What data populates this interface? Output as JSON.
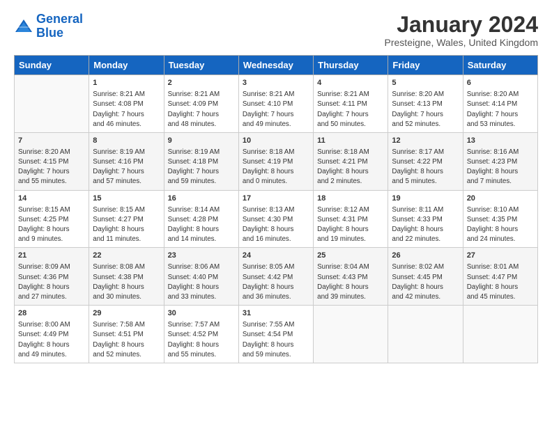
{
  "header": {
    "logo_line1": "General",
    "logo_line2": "Blue",
    "title": "January 2024",
    "subtitle": "Presteigne, Wales, United Kingdom"
  },
  "days_of_week": [
    "Sunday",
    "Monday",
    "Tuesday",
    "Wednesday",
    "Thursday",
    "Friday",
    "Saturday"
  ],
  "weeks": [
    [
      {
        "num": "",
        "data": []
      },
      {
        "num": "1",
        "data": [
          "Sunrise: 8:21 AM",
          "Sunset: 4:08 PM",
          "Daylight: 7 hours",
          "and 46 minutes."
        ]
      },
      {
        "num": "2",
        "data": [
          "Sunrise: 8:21 AM",
          "Sunset: 4:09 PM",
          "Daylight: 7 hours",
          "and 48 minutes."
        ]
      },
      {
        "num": "3",
        "data": [
          "Sunrise: 8:21 AM",
          "Sunset: 4:10 PM",
          "Daylight: 7 hours",
          "and 49 minutes."
        ]
      },
      {
        "num": "4",
        "data": [
          "Sunrise: 8:21 AM",
          "Sunset: 4:11 PM",
          "Daylight: 7 hours",
          "and 50 minutes."
        ]
      },
      {
        "num": "5",
        "data": [
          "Sunrise: 8:20 AM",
          "Sunset: 4:13 PM",
          "Daylight: 7 hours",
          "and 52 minutes."
        ]
      },
      {
        "num": "6",
        "data": [
          "Sunrise: 8:20 AM",
          "Sunset: 4:14 PM",
          "Daylight: 7 hours",
          "and 53 minutes."
        ]
      }
    ],
    [
      {
        "num": "7",
        "data": [
          "Sunrise: 8:20 AM",
          "Sunset: 4:15 PM",
          "Daylight: 7 hours",
          "and 55 minutes."
        ]
      },
      {
        "num": "8",
        "data": [
          "Sunrise: 8:19 AM",
          "Sunset: 4:16 PM",
          "Daylight: 7 hours",
          "and 57 minutes."
        ]
      },
      {
        "num": "9",
        "data": [
          "Sunrise: 8:19 AM",
          "Sunset: 4:18 PM",
          "Daylight: 7 hours",
          "and 59 minutes."
        ]
      },
      {
        "num": "10",
        "data": [
          "Sunrise: 8:18 AM",
          "Sunset: 4:19 PM",
          "Daylight: 8 hours",
          "and 0 minutes."
        ]
      },
      {
        "num": "11",
        "data": [
          "Sunrise: 8:18 AM",
          "Sunset: 4:21 PM",
          "Daylight: 8 hours",
          "and 2 minutes."
        ]
      },
      {
        "num": "12",
        "data": [
          "Sunrise: 8:17 AM",
          "Sunset: 4:22 PM",
          "Daylight: 8 hours",
          "and 5 minutes."
        ]
      },
      {
        "num": "13",
        "data": [
          "Sunrise: 8:16 AM",
          "Sunset: 4:23 PM",
          "Daylight: 8 hours",
          "and 7 minutes."
        ]
      }
    ],
    [
      {
        "num": "14",
        "data": [
          "Sunrise: 8:15 AM",
          "Sunset: 4:25 PM",
          "Daylight: 8 hours",
          "and 9 minutes."
        ]
      },
      {
        "num": "15",
        "data": [
          "Sunrise: 8:15 AM",
          "Sunset: 4:27 PM",
          "Daylight: 8 hours",
          "and 11 minutes."
        ]
      },
      {
        "num": "16",
        "data": [
          "Sunrise: 8:14 AM",
          "Sunset: 4:28 PM",
          "Daylight: 8 hours",
          "and 14 minutes."
        ]
      },
      {
        "num": "17",
        "data": [
          "Sunrise: 8:13 AM",
          "Sunset: 4:30 PM",
          "Daylight: 8 hours",
          "and 16 minutes."
        ]
      },
      {
        "num": "18",
        "data": [
          "Sunrise: 8:12 AM",
          "Sunset: 4:31 PM",
          "Daylight: 8 hours",
          "and 19 minutes."
        ]
      },
      {
        "num": "19",
        "data": [
          "Sunrise: 8:11 AM",
          "Sunset: 4:33 PM",
          "Daylight: 8 hours",
          "and 22 minutes."
        ]
      },
      {
        "num": "20",
        "data": [
          "Sunrise: 8:10 AM",
          "Sunset: 4:35 PM",
          "Daylight: 8 hours",
          "and 24 minutes."
        ]
      }
    ],
    [
      {
        "num": "21",
        "data": [
          "Sunrise: 8:09 AM",
          "Sunset: 4:36 PM",
          "Daylight: 8 hours",
          "and 27 minutes."
        ]
      },
      {
        "num": "22",
        "data": [
          "Sunrise: 8:08 AM",
          "Sunset: 4:38 PM",
          "Daylight: 8 hours",
          "and 30 minutes."
        ]
      },
      {
        "num": "23",
        "data": [
          "Sunrise: 8:06 AM",
          "Sunset: 4:40 PM",
          "Daylight: 8 hours",
          "and 33 minutes."
        ]
      },
      {
        "num": "24",
        "data": [
          "Sunrise: 8:05 AM",
          "Sunset: 4:42 PM",
          "Daylight: 8 hours",
          "and 36 minutes."
        ]
      },
      {
        "num": "25",
        "data": [
          "Sunrise: 8:04 AM",
          "Sunset: 4:43 PM",
          "Daylight: 8 hours",
          "and 39 minutes."
        ]
      },
      {
        "num": "26",
        "data": [
          "Sunrise: 8:02 AM",
          "Sunset: 4:45 PM",
          "Daylight: 8 hours",
          "and 42 minutes."
        ]
      },
      {
        "num": "27",
        "data": [
          "Sunrise: 8:01 AM",
          "Sunset: 4:47 PM",
          "Daylight: 8 hours",
          "and 45 minutes."
        ]
      }
    ],
    [
      {
        "num": "28",
        "data": [
          "Sunrise: 8:00 AM",
          "Sunset: 4:49 PM",
          "Daylight: 8 hours",
          "and 49 minutes."
        ]
      },
      {
        "num": "29",
        "data": [
          "Sunrise: 7:58 AM",
          "Sunset: 4:51 PM",
          "Daylight: 8 hours",
          "and 52 minutes."
        ]
      },
      {
        "num": "30",
        "data": [
          "Sunrise: 7:57 AM",
          "Sunset: 4:52 PM",
          "Daylight: 8 hours",
          "and 55 minutes."
        ]
      },
      {
        "num": "31",
        "data": [
          "Sunrise: 7:55 AM",
          "Sunset: 4:54 PM",
          "Daylight: 8 hours",
          "and 59 minutes."
        ]
      },
      {
        "num": "",
        "data": []
      },
      {
        "num": "",
        "data": []
      },
      {
        "num": "",
        "data": []
      }
    ]
  ]
}
